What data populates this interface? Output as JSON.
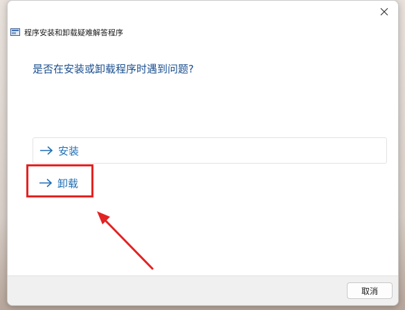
{
  "window": {
    "title": "程序安装和卸载疑难解答程序",
    "question": "是否在安装或卸载程序时遇到问题?"
  },
  "options": [
    {
      "label": "安装",
      "icon": "arrow-right-icon"
    },
    {
      "label": "卸载",
      "icon": "arrow-right-icon"
    }
  ],
  "footer": {
    "cancel_label": "取消"
  },
  "colors": {
    "accent": "#1f6fb5",
    "question": "#1a4f8f",
    "annotation": "#e32222"
  }
}
